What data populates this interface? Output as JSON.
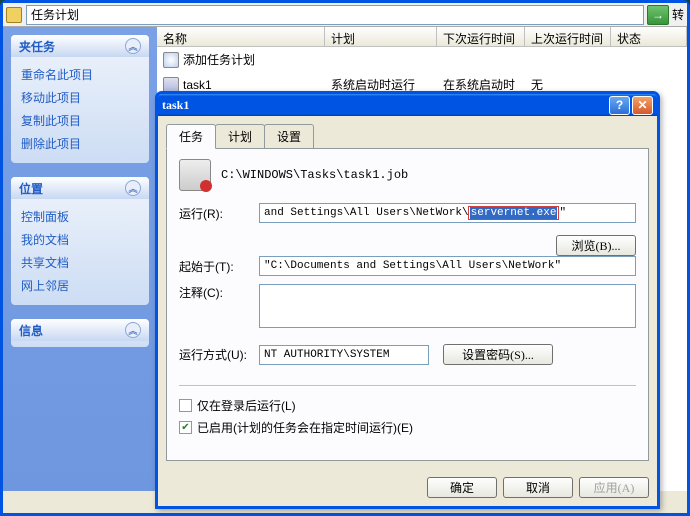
{
  "main_window": {
    "title": "任务计划",
    "go_button": "转"
  },
  "sidebar": {
    "panel1": {
      "title": "夹任务",
      "items": [
        "重命名此项目",
        "移动此项目",
        "复制此项目",
        "删除此项目"
      ]
    },
    "panel2": {
      "title": "位置",
      "items": [
        "控制面板",
        "我的文档",
        "共享文档",
        "网上邻居"
      ]
    },
    "panel3": {
      "title": "信息"
    }
  },
  "list": {
    "headers": {
      "name": "名称",
      "schedule": "计划",
      "next_run": "下次运行时间",
      "last_run": "上次运行时间",
      "status": "状态"
    },
    "rows": [
      {
        "name": "添加任务计划",
        "schedule": "",
        "next_run": "",
        "last_run": "",
        "status": ""
      },
      {
        "name": "task1",
        "schedule": "系统启动时运行",
        "next_run": "在系统启动时",
        "last_run": "无",
        "status": ""
      }
    ]
  },
  "dialog": {
    "title": "task1",
    "tabs": {
      "task": "任务",
      "schedule": "计划",
      "settings": "设置"
    },
    "job_path": "C:\\WINDOWS\\Tasks\\task1.job",
    "labels": {
      "run": "运行(R):",
      "browse": "浏览(B)...",
      "start_in": "起始于(T):",
      "comment": "注释(C):",
      "run_as": "运行方式(U):",
      "set_password": "设置密码(S)...",
      "only_logged": "仅在登录后运行(L)",
      "enabled": "已启用(计划的任务会在指定时间运行)(E)"
    },
    "values": {
      "run_prefix": "and Settings\\All Users\\NetWork\\",
      "run_highlight": "servernet.exe",
      "run_suffix": "\"",
      "start_in": "\"C:\\Documents and Settings\\All Users\\NetWork\"",
      "comment": "",
      "run_as": "NT AUTHORITY\\SYSTEM",
      "only_logged_checked": false,
      "enabled_checked": true
    },
    "buttons": {
      "ok": "确定",
      "cancel": "取消",
      "apply": "应用(A)"
    }
  }
}
